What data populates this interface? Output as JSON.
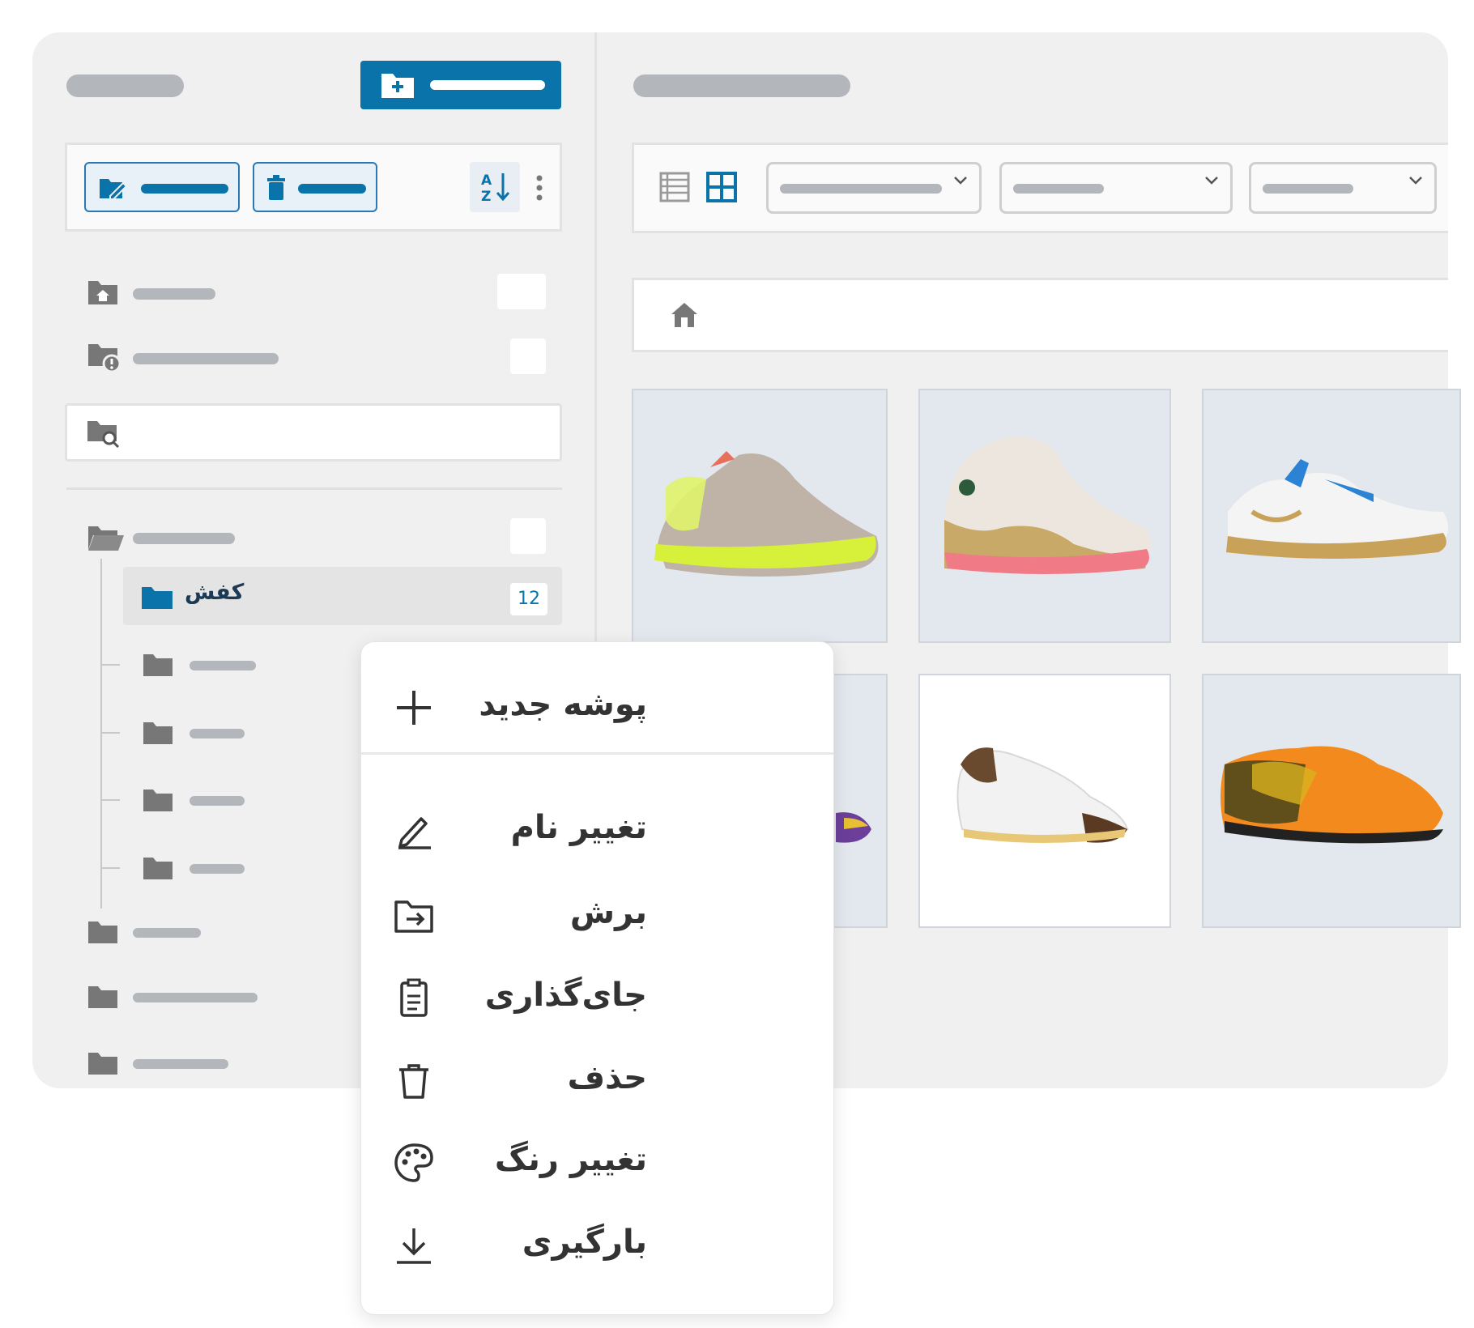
{
  "sidebar": {
    "selected_folder": {
      "label": "کفش",
      "count": "12"
    }
  },
  "context_menu": {
    "items": [
      {
        "label": "پوشه جدید",
        "icon": "plus-icon"
      },
      {
        "label": "تغییر نام",
        "icon": "pencil-icon"
      },
      {
        "label": "برش",
        "icon": "folder-move-icon"
      },
      {
        "label": "جای‌گذاری",
        "icon": "clipboard-icon"
      },
      {
        "label": "حذف",
        "icon": "trash-icon"
      },
      {
        "label": "تغییر رنگ",
        "icon": "palette-icon"
      },
      {
        "label": "بارگیری",
        "icon": "download-icon"
      }
    ]
  },
  "colors": {
    "accent": "#0a73aa",
    "panel": "#f0f0f0",
    "placeholder": "#b3b6ba"
  }
}
